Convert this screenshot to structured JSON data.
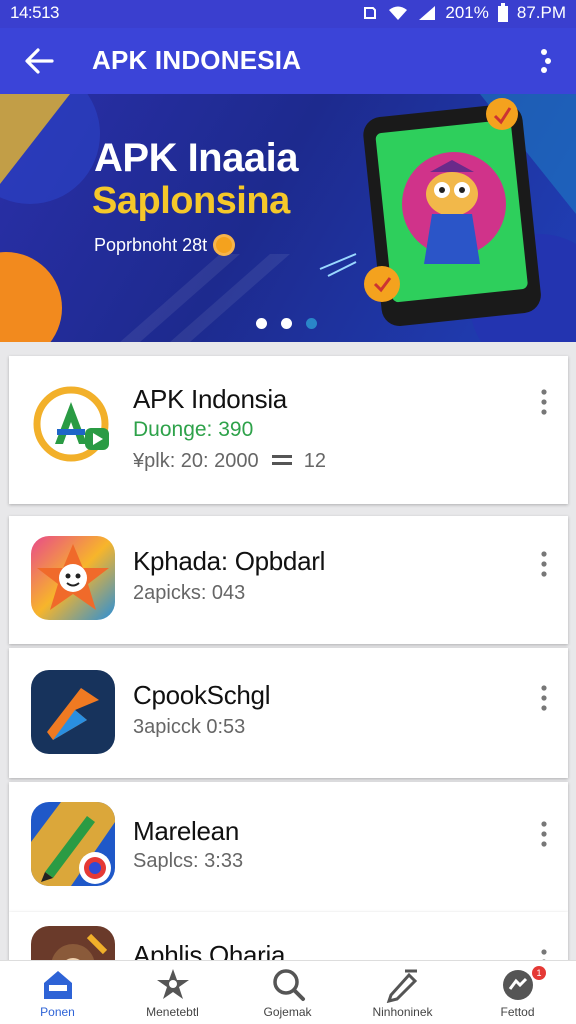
{
  "status_bar": {
    "time": "14:513",
    "battery": "201%",
    "clock": "87.PM"
  },
  "app_bar": {
    "title": "APK INDONESIA",
    "back_icon": "arrow-left-icon",
    "menu_icon": "more-vert-icon"
  },
  "banner": {
    "headline": "APK Inaaia",
    "subheadline": "Saplonsina",
    "caption": "Poprbnoht 28t",
    "pager": {
      "count": 3,
      "active": 2
    }
  },
  "apps": [
    {
      "name": "APK Indonsia",
      "highlight": "Duonge: 390",
      "meta": "¥plk: 20: 2000",
      "extra": "12",
      "icon": "apk-indonesia-logo-icon"
    },
    {
      "name": "Kphada: Opbdarl",
      "meta": "2apicks: 043",
      "icon": "star-character-icon"
    },
    {
      "name": "CpookSchgl",
      "meta": "3apicck 0:53",
      "icon": "arrow-logo-icon"
    },
    {
      "name": "Marelean",
      "meta": "Saplcs: 3:33",
      "icon": "pen-logo-icon"
    },
    {
      "name": "Aphlis Oharia",
      "meta": "",
      "icon": "monkey-icon"
    }
  ],
  "bottom_nav": [
    {
      "label": "Ponen",
      "icon": "home-icon",
      "active": true
    },
    {
      "label": "Menetebtl",
      "icon": "star-person-icon",
      "active": false
    },
    {
      "label": "Gojemak",
      "icon": "search-icon",
      "active": false
    },
    {
      "label": "Ninhoninek",
      "icon": "pen-icon",
      "active": false
    },
    {
      "label": "Fettod",
      "icon": "profile-icon",
      "active": false,
      "badge": "1"
    }
  ],
  "colors": {
    "primary": "#3b44d8",
    "accent": "#f5c82a",
    "green": "#2ea24a",
    "nav_active": "#2e63d6"
  }
}
